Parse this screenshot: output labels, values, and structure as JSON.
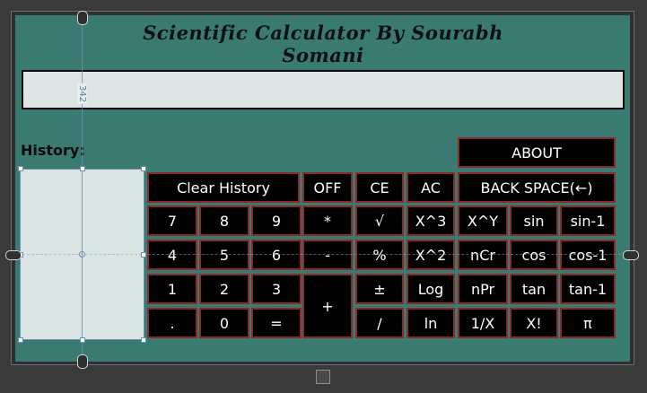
{
  "title": "Scientific Calculator By Sourabh Somani",
  "history_label": "History:",
  "guide_measure": "342",
  "buttons": {
    "about": "ABOUT",
    "clear_history": "Clear History",
    "off": "OFF",
    "ce": "CE",
    "ac": "AC",
    "backspace": "BACK SPACE(←)",
    "n7": "7",
    "n8": "8",
    "n9": "9",
    "mul": "*",
    "sqrt": "√",
    "x3": "X^3",
    "xy": "X^Y",
    "sin": "sin",
    "sin_inv": "sin-1",
    "n4": "4",
    "n5": "5",
    "n6": "6",
    "minus": "-",
    "percent": "%",
    "x2": "X^2",
    "ncr": "nCr",
    "cos": "cos",
    "cos_inv": "cos-1",
    "n1": "1",
    "n2": "2",
    "n3": "3",
    "plus": "+",
    "plusminus": "±",
    "log": "Log",
    "npr": "nPr",
    "tan": "tan",
    "tan_inv": "tan-1",
    "dot": ".",
    "n0": "0",
    "equals": "=",
    "div": "/",
    "ln": "ln",
    "reciprocal": "1/X",
    "fact": "X!",
    "pi": "π"
  }
}
